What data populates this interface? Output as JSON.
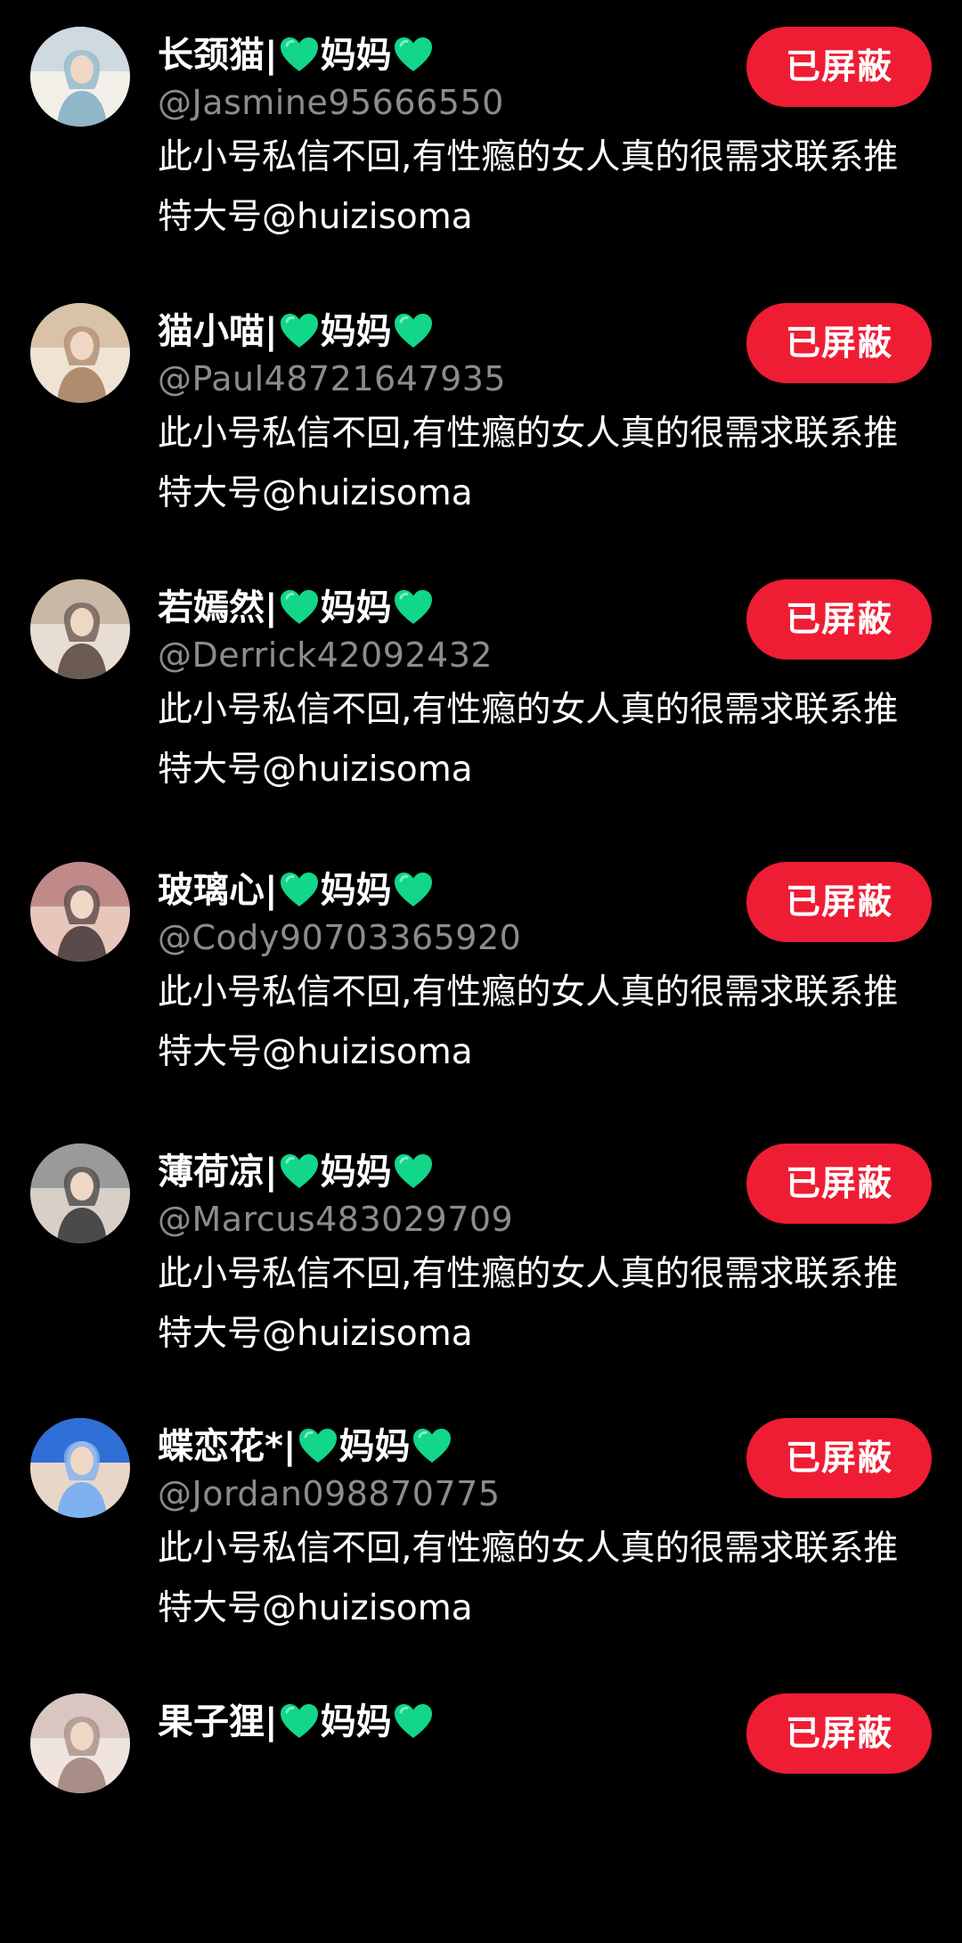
{
  "list": {
    "items": [
      {
        "name_prefix": "长颈猫|",
        "name_mid": "妈妈",
        "handle": "@Jasmine95666550",
        "bio_line1": "此小号私信不回,有性瘾的女人真的很需求联系推",
        "bio_line2": "特大号@huizisoma",
        "button_label": "已屏蔽"
      },
      {
        "name_prefix": "猫小喵|",
        "name_mid": "妈妈",
        "handle": "@Paul48721647935",
        "bio_line1": "此小号私信不回,有性瘾的女人真的很需求联系推",
        "bio_line2": "特大号@huizisoma",
        "button_label": "已屏蔽"
      },
      {
        "name_prefix": "若嫣然|",
        "name_mid": "妈妈",
        "handle": "@Derrick42092432",
        "bio_line1": "此小号私信不回,有性瘾的女人真的很需求联系推",
        "bio_line2": "特大号@huizisoma",
        "button_label": "已屏蔽"
      },
      {
        "name_prefix": "玻璃心|",
        "name_mid": "妈妈",
        "handle": "@Cody90703365920",
        "bio_line1": "此小号私信不回,有性瘾的女人真的很需求联系推",
        "bio_line2": "特大号@huizisoma",
        "button_label": "已屏蔽"
      },
      {
        "name_prefix": "薄荷凉|",
        "name_mid": "妈妈",
        "handle": "@Marcus483029709",
        "bio_line1": "此小号私信不回,有性瘾的女人真的很需求联系推",
        "bio_line2": "特大号@huizisoma",
        "button_label": "已屏蔽"
      },
      {
        "name_prefix": "蝶恋花*|",
        "name_mid": "妈妈",
        "handle": "@Jordan098870775",
        "bio_line1": "此小号私信不回,有性瘾的女人真的很需求联系推",
        "bio_line2": "特大号@huizisoma",
        "button_label": "已屏蔽"
      },
      {
        "name_prefix": "果子狸|",
        "name_mid": "妈妈",
        "handle": "",
        "bio_line1": "",
        "bio_line2": "",
        "button_label": "已屏蔽"
      }
    ]
  },
  "colors": {
    "background": "#000000",
    "button": "#ee1d34",
    "handle": "#8c8c8c",
    "heart": "#12d68a"
  },
  "icons": {
    "heart": "green-heart-icon",
    "avatar": "profile-photo"
  }
}
